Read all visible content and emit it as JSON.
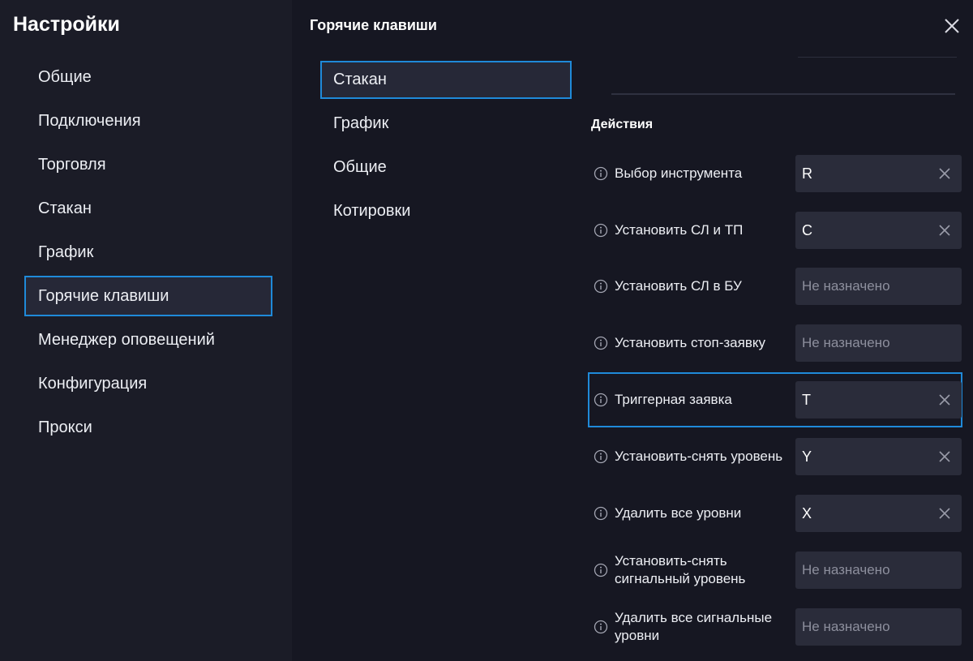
{
  "sidebar": {
    "title": "Настройки",
    "items": [
      {
        "label": "Общие",
        "active": false
      },
      {
        "label": "Подключения",
        "active": false
      },
      {
        "label": "Торговля",
        "active": false
      },
      {
        "label": "Стакан",
        "active": false
      },
      {
        "label": "График",
        "active": false
      },
      {
        "label": "Горячие клавиши",
        "active": true
      },
      {
        "label": "Менеджер оповещений",
        "active": false
      },
      {
        "label": "Конфигурация",
        "active": false
      },
      {
        "label": "Прокси",
        "active": false
      }
    ]
  },
  "main": {
    "title": "Горячие клавиши",
    "subnav": [
      {
        "label": "Стакан",
        "active": true
      },
      {
        "label": "График",
        "active": false
      },
      {
        "label": "Общие",
        "active": false
      },
      {
        "label": "Котировки",
        "active": false
      }
    ],
    "section_title": "Действия",
    "actions": [
      {
        "label": "Выбор инструмента",
        "key": "R",
        "assigned": true,
        "active": false
      },
      {
        "label": "Установить СЛ и ТП",
        "key": "C",
        "assigned": true,
        "active": false
      },
      {
        "label": "Установить СЛ в БУ",
        "key": "Не назначено",
        "assigned": false,
        "active": false
      },
      {
        "label": "Установить стоп-заявку",
        "key": "Не назначено",
        "assigned": false,
        "active": false
      },
      {
        "label": "Триггерная заявка",
        "key": "T",
        "assigned": true,
        "active": true
      },
      {
        "label": "Установить-снять уровень",
        "key": "Y",
        "assigned": true,
        "active": false
      },
      {
        "label": "Удалить все уровни",
        "key": "X",
        "assigned": true,
        "active": false
      },
      {
        "label": "Установить-снять сигнальный уровень",
        "key": "Не назначено",
        "assigned": false,
        "active": false
      },
      {
        "label": "Удалить все сигнальные уровни",
        "key": "Не назначено",
        "assigned": false,
        "active": false
      }
    ]
  },
  "colors": {
    "accent": "#1f8ad9",
    "sidebar_bg": "#1b1c27",
    "main_bg": "#161722",
    "field_bg": "#2a2c3a"
  },
  "icons": {
    "close": "close-icon",
    "info": "info-icon",
    "clear": "clear-icon"
  }
}
